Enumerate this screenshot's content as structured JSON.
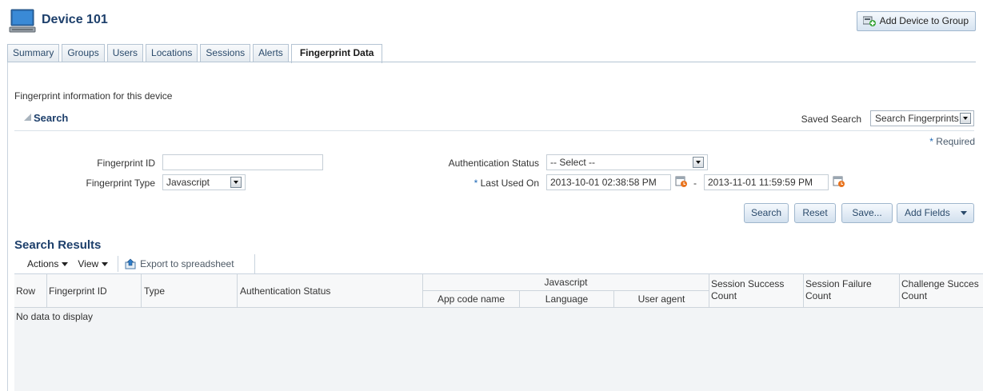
{
  "header": {
    "title": "Device 101",
    "add_to_group_label": "Add Device to Group"
  },
  "tabs": [
    {
      "label": "Summary"
    },
    {
      "label": "Groups"
    },
    {
      "label": "Users"
    },
    {
      "label": "Locations"
    },
    {
      "label": "Sessions"
    },
    {
      "label": "Alerts"
    },
    {
      "label": "Fingerprint Data",
      "active": true
    }
  ],
  "intro_text": "Fingerprint information for this device",
  "search": {
    "title": "Search",
    "saved_search_label": "Saved Search",
    "saved_search_value": "Search Fingerprints",
    "required_note": "Required",
    "fingerprint_id_label": "Fingerprint ID",
    "fingerprint_id_value": "",
    "fingerprint_type_label": "Fingerprint Type",
    "fingerprint_type_value": "Javascript",
    "auth_status_label": "Authentication Status",
    "auth_status_value": "-- Select --",
    "last_used_label": "Last Used On",
    "last_used_from": "2013-10-01 02:38:58 PM",
    "range_dash": "-",
    "last_used_to": "2013-11-01 11:59:59 PM",
    "buttons": {
      "search": "Search",
      "reset": "Reset",
      "save": "Save...",
      "add_fields": "Add Fields"
    }
  },
  "results": {
    "title": "Search Results",
    "toolbar": {
      "actions": "Actions",
      "view": "View",
      "export": "Export to spreadsheet"
    },
    "columns": {
      "row": "Row",
      "fingerprint_id": "Fingerprint ID",
      "type": "Type",
      "auth_status": "Authentication Status",
      "javascript_group": "Javascript",
      "app_code_name": "App code name",
      "language": "Language",
      "user_agent": "User agent",
      "session_success_1": "Session Success",
      "session_success_2": "Count",
      "session_failure_1": "Session Failure",
      "session_failure_2": "Count",
      "challenge_success_1": "Challenge Succes",
      "challenge_success_2": "Count"
    },
    "empty_message": "No data to display"
  },
  "colors": {
    "title_blue": "#1d3f6b",
    "required_star": "#1d68b6"
  }
}
